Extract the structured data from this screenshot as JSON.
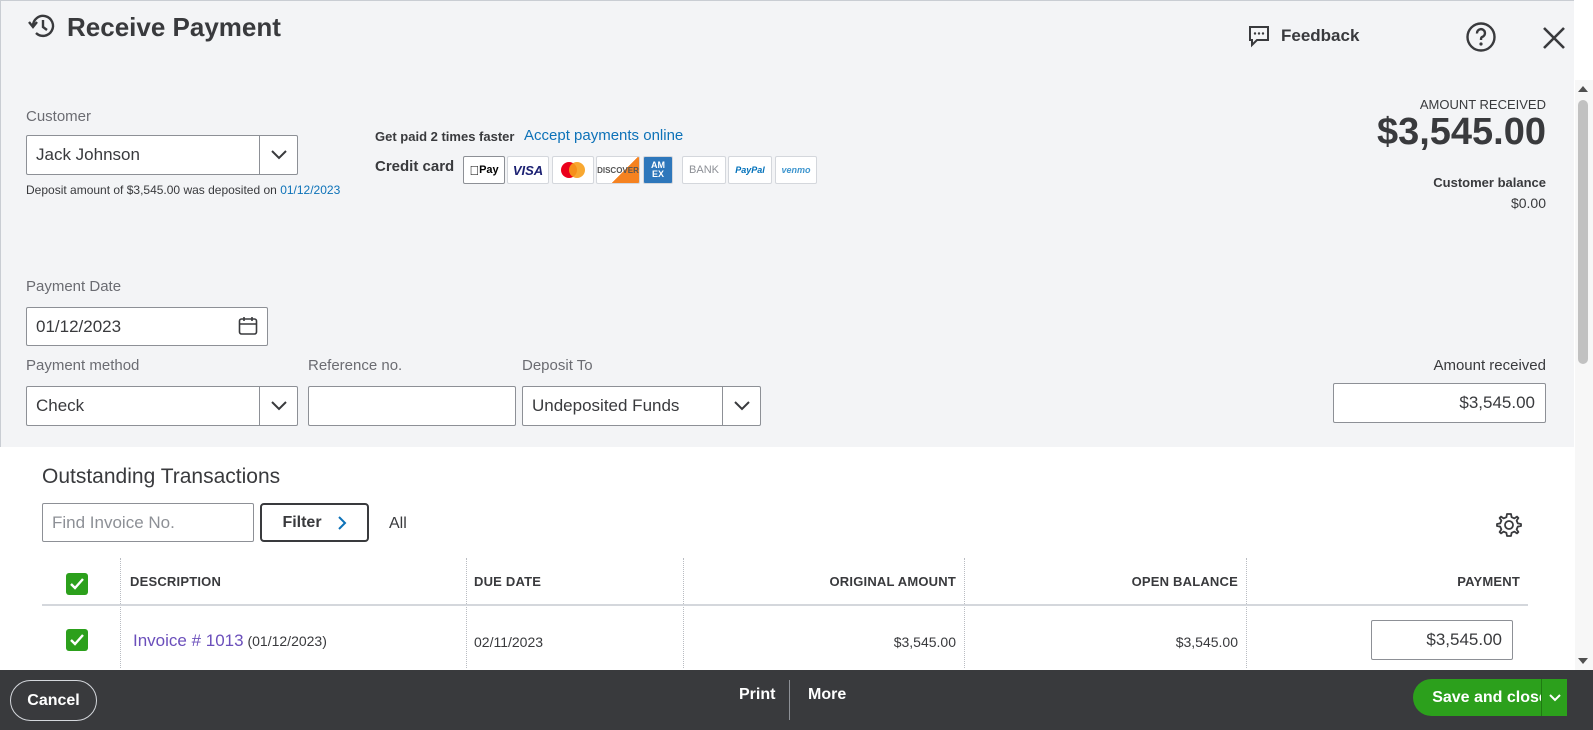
{
  "header": {
    "title": "Receive Payment",
    "feedback_label": "Feedback"
  },
  "customer": {
    "label": "Customer",
    "value": "Jack Johnson",
    "deposit_note": "Deposit amount of $3,545.00 was deposited on",
    "deposit_date": "01/12/2023"
  },
  "online": {
    "promo": "Get paid 2 times faster",
    "accept_link": "Accept payments online",
    "credit_card_label": "Credit card",
    "logos": [
      "Pay",
      "VISA",
      "",
      "DISCOVER",
      "AM EX",
      "BANK",
      "PayPal",
      "venmo"
    ]
  },
  "summary": {
    "amount_received_label": "AMOUNT RECEIVED",
    "amount_received_value": "$3,545.00",
    "customer_balance_label": "Customer balance",
    "customer_balance_value": "$0.00"
  },
  "payment": {
    "date_label": "Payment Date",
    "date_value": "01/12/2023",
    "method_label": "Payment method",
    "method_value": "Check",
    "reference_label": "Reference no.",
    "reference_value": "",
    "deposit_to_label": "Deposit To",
    "deposit_to_value": "Undeposited Funds",
    "amount_label": "Amount received",
    "amount_value": "$3,545.00"
  },
  "outstanding": {
    "title": "Outstanding Transactions",
    "search_placeholder": "Find Invoice No.",
    "filter_label": "Filter",
    "all_label": "All",
    "columns": [
      "DESCRIPTION",
      "DUE DATE",
      "ORIGINAL AMOUNT",
      "OPEN BALANCE",
      "PAYMENT"
    ],
    "rows": [
      {
        "invoice": "Invoice # 1013",
        "invoice_date": "(01/12/2023)",
        "due_date": "02/11/2023",
        "original_amount": "$3,545.00",
        "open_balance": "$3,545.00",
        "payment": "$3,545.00"
      }
    ]
  },
  "footer": {
    "cancel_label": "Cancel",
    "print_label": "Print",
    "more_label": "More",
    "save_label": "Save and close"
  },
  "colors": {
    "accent_green": "#2ca01c",
    "link_blue": "#0d72b8",
    "invoice_purple": "#6b4fbb",
    "footer_bg": "#393a3d"
  }
}
